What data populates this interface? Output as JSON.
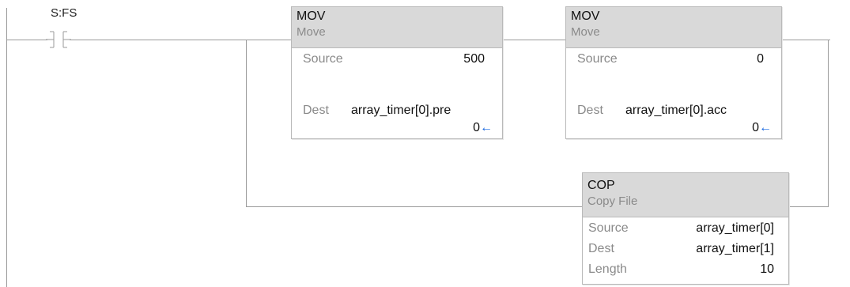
{
  "rung": {
    "contact": {
      "tag": "S:FS"
    },
    "mov1": {
      "name": "MOV",
      "desc": "Move",
      "source_label": "Source",
      "source_value": "500",
      "dest_label": "Dest",
      "dest_tag": "array_timer[0].pre",
      "dest_value": "0"
    },
    "mov2": {
      "name": "MOV",
      "desc": "Move",
      "source_label": "Source",
      "source_value": "0",
      "dest_label": "Dest",
      "dest_tag": "array_timer[0].acc",
      "dest_value": "0"
    },
    "cop": {
      "name": "COP",
      "desc": "Copy File",
      "source_label": "Source",
      "source_value": "array_timer[0]",
      "dest_label": "Dest",
      "dest_value": "array_timer[1]",
      "length_label": "Length",
      "length_value": "10"
    }
  },
  "icons": {
    "output_arrow": "←"
  },
  "colors": {
    "wire": "#9a9a9a",
    "header": "#d9d9d9",
    "arrow": "#1565e0"
  }
}
